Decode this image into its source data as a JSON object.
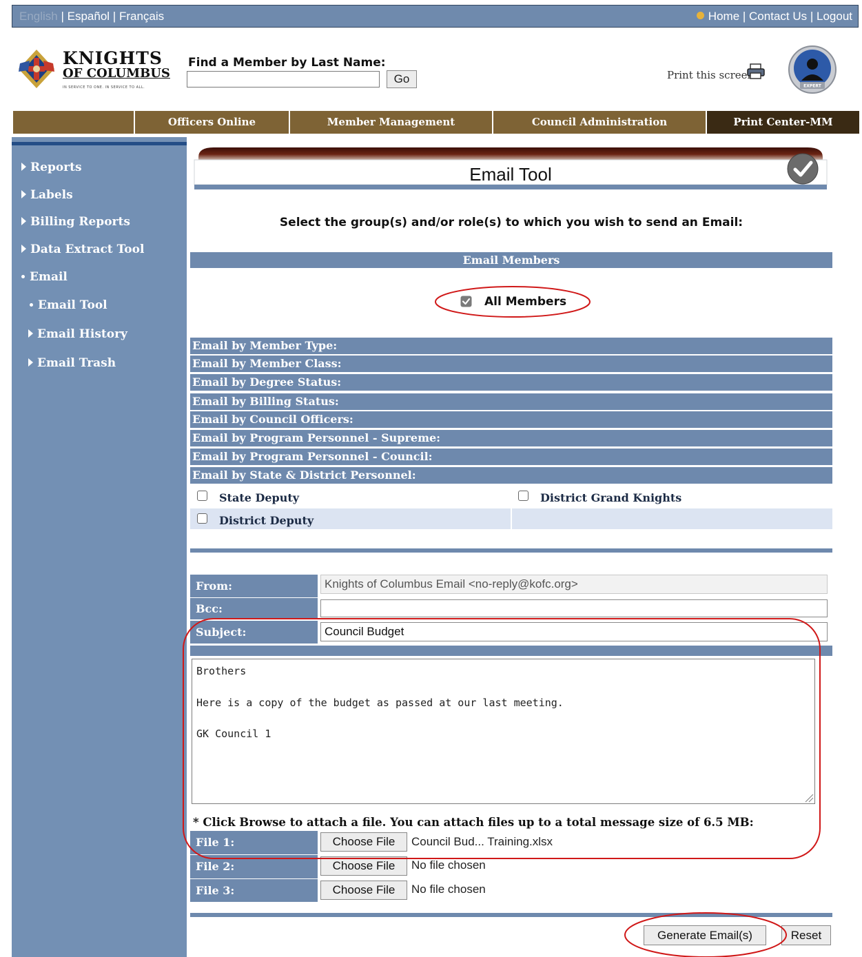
{
  "language_bar": {
    "current": "English",
    "others": [
      "Español",
      "Français"
    ],
    "separator": " | "
  },
  "top_links": [
    "Home",
    "Contact Us",
    "Logout"
  ],
  "logo": {
    "line1": "KNIGHTS",
    "line2": "OF COLUMBUS",
    "tagline": "IN SERVICE TO ONE. IN SERVICE TO ALL."
  },
  "search": {
    "label": "Find a Member by Last Name:",
    "value": "",
    "go_label": "Go"
  },
  "print_link": "Print this screen",
  "badge_text": "EXPERT",
  "nav_tabs": [
    "",
    "Officers Online",
    "Member Management",
    "Council Administration",
    "Print Center-MM"
  ],
  "sidebar": {
    "items": [
      "Reports",
      "Labels",
      "Billing Reports",
      "Data Extract Tool",
      "Email"
    ],
    "sub_items": [
      "Email Tool",
      "Email History",
      "Email Trash"
    ]
  },
  "page": {
    "title": "Email Tool",
    "instruction": "Select the group(s) and/or role(s) to which you wish to send an Email:",
    "email_members_header": "Email Members",
    "all_members_label": "All Members",
    "all_members_checked": true
  },
  "sections": [
    "Email by Member Type:",
    "Email by Member Class:",
    "Email by Degree Status:",
    "Email by Billing Status:",
    "Email by Council Officers:",
    "Email by Program Personnel - Supreme:",
    "Email by Program Personnel - Council:",
    "Email by State & District Personnel:"
  ],
  "personnel_options": [
    "State Deputy",
    "District Grand Knights",
    "District Deputy"
  ],
  "form": {
    "from_label": "From:",
    "from_value": "Knights of Columbus Email <no-reply@kofc.org>",
    "bcc_label": "Bcc:",
    "bcc_value": "",
    "subject_label": "Subject:",
    "subject_value": "Council Budget",
    "message": "Brothers\n\nHere is a copy of the budget as passed at our last meeting.\n\nGK Council 1",
    "attach_note": "* Click Browse to attach a file. You can attach files up to a total message size of 6.5 MB:",
    "choose_label": "Choose File",
    "files": [
      {
        "label": "File 1:",
        "name": "Council Bud... Training.xlsx"
      },
      {
        "label": "File 2:",
        "name": "No file chosen"
      },
      {
        "label": "File 3:",
        "name": "No file chosen"
      }
    ],
    "generate_label": "Generate Email(s)",
    "reset_label": "Reset"
  },
  "colors": {
    "topbar": "#6f8aad",
    "nav": "#7e6335",
    "sidebar": "#7390b4",
    "section_bar": "#6e89ad",
    "annotation": "#d01818",
    "title_band": "#5c1d10"
  }
}
